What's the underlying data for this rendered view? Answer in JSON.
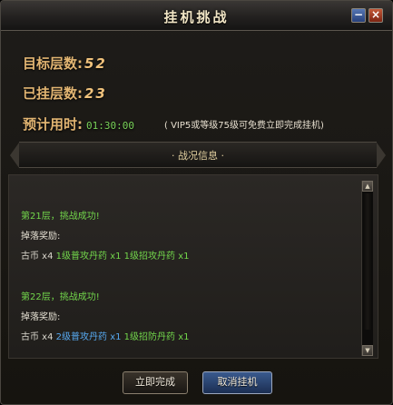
{
  "window": {
    "title": "挂机挑战"
  },
  "stats": {
    "target_label": "目标层数:",
    "target_value": "52",
    "done_label": "已挂层数:",
    "done_value": "23",
    "time_label": "预计用时:",
    "time_value": "01:30:00",
    "tip": "( VIP5或等级75级可免费立即完成挂机)"
  },
  "banner": {
    "label": "· 战况信息 ·"
  },
  "log": {
    "entries": [
      {
        "title": "第21层，挑战成功!",
        "reward_label": "掉落奖励:",
        "coin": "古币 x4",
        "item1": "1级普攻丹药 x1",
        "item2": "1级招攻丹药 x1"
      },
      {
        "title": "第22层，挑战成功!",
        "reward_label": "掉落奖励:",
        "coin": "古币 x4",
        "item1": "2级普攻丹药 x1",
        "item2": "1级招防丹药 x1"
      }
    ]
  },
  "buttons": {
    "complete": "立即完成",
    "cancel": "取消挂机"
  },
  "colors": {
    "accent": "#e2b572",
    "success": "#72d64b",
    "rare_item": "#57a9f0"
  }
}
